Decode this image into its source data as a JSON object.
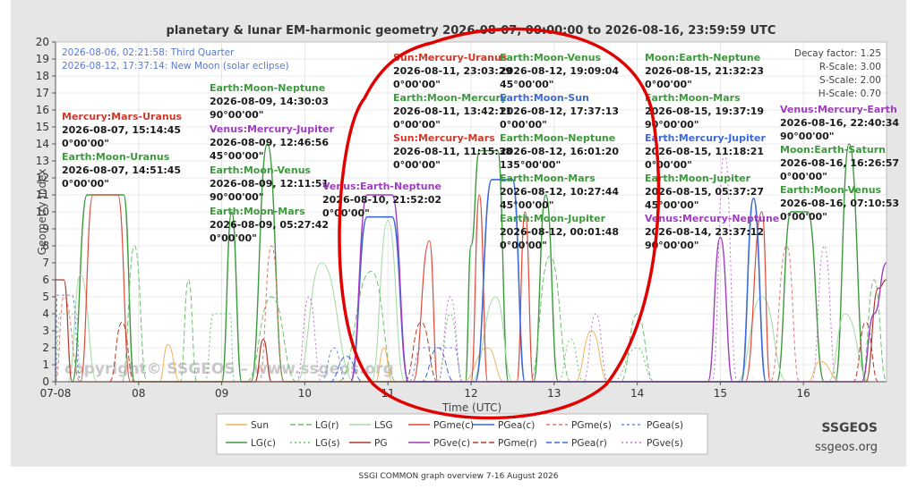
{
  "caption": "SSGI COMMON graph overview 7-16 August 2026",
  "brand": {
    "name": "SSGEOS",
    "site": "ssgeos.org",
    "watermark": "copyright© SSGEOS – www.ssgeos.org"
  },
  "colors": {
    "frame": "#e6e6e6",
    "plot_bg": "#ffffff",
    "grid": "#e2e2e2",
    "highlight_circle": "#e00000"
  },
  "chart_data": {
    "type": "line",
    "title": "planetary & lunar EM-harmonic geometry 2026-08-07, 00:00:00 to 2026-08-16, 23:59:59 UTC",
    "xlabel": "Time (UTC)",
    "ylabel": "Geometry Index",
    "xlim": [
      0,
      10
    ],
    "ylim": [
      0,
      20
    ],
    "x_ticks": [
      {
        "v": 0,
        "label": "07-08"
      },
      {
        "v": 1,
        "label": "08"
      },
      {
        "v": 2,
        "label": "09"
      },
      {
        "v": 3,
        "label": "10"
      },
      {
        "v": 4,
        "label": "11"
      },
      {
        "v": 5,
        "label": "12"
      },
      {
        "v": 6,
        "label": "13"
      },
      {
        "v": 7,
        "label": "14"
      },
      {
        "v": 8,
        "label": "15"
      },
      {
        "v": 9,
        "label": "16"
      }
    ],
    "y_ticks": [
      0,
      1,
      2,
      3,
      4,
      5,
      6,
      7,
      8,
      9,
      10,
      11,
      12,
      13,
      14,
      15,
      16,
      17,
      18,
      19,
      20
    ],
    "grid": true,
    "moon_phases": [
      {
        "text": "2026-08-06, 02:21:58: Third Quarter"
      },
      {
        "text": "2026-08-12, 17:37:14: New Moon (solar eclipse)"
      }
    ],
    "scale_info": [
      {
        "label": "Decay factor:",
        "value": "1.25"
      },
      {
        "label": "R-Scale:",
        "value": "3.00"
      },
      {
        "label": "S-Scale:",
        "value": "2.00"
      },
      {
        "label": "H-Scale:",
        "value": "0.70"
      }
    ],
    "events": [
      {
        "name": "Mercury:Mars-Uranus",
        "time": "2026-08-07, 15:14:45",
        "angle": "0°00'00\"",
        "color": "#d03a2a",
        "col": 0,
        "row": 0
      },
      {
        "name": "Earth:Moon-Uranus",
        "time": "2026-08-07, 14:51:45",
        "angle": "0°00'00\"",
        "color": "#3c9a3c",
        "col": 0,
        "row": 1
      },
      {
        "name": "Earth:Moon-Neptune",
        "time": "2026-08-09, 14:30:03",
        "angle": "90°00'00\"",
        "color": "#3c9a3c",
        "col": 1,
        "row": 0
      },
      {
        "name": "Venus:Mercury-Jupiter",
        "time": "2026-08-09, 12:46:56",
        "angle": "45°00'00\"",
        "color": "#a03cc0",
        "col": 1,
        "row": 1
      },
      {
        "name": "Earth:Moon-Venus",
        "time": "2026-08-09, 12:11:51",
        "angle": "90°00'00\"",
        "color": "#3c9a3c",
        "col": 1,
        "row": 2
      },
      {
        "name": "Earth:Moon-Mars",
        "time": "2026-08-09, 05:27:42",
        "angle": "0°00'00\"",
        "color": "#3c9a3c",
        "col": 1,
        "row": 3
      },
      {
        "name": "Venus:Earth-Neptune",
        "time": "2026-08-10, 21:52:02",
        "angle": "0°00'00\"",
        "color": "#a03cc0",
        "col": 2,
        "row": 0
      },
      {
        "name": "Sun:Mercury-Uranus",
        "time": "2026-08-11, 23:03:29",
        "angle": "0°00'00\"",
        "color": "#d03a2a",
        "col": 3,
        "row": 0
      },
      {
        "name": "Earth:Moon-Mercury",
        "time": "2026-08-11, 13:42:11",
        "angle": "0°00'00\"",
        "color": "#3c9a3c",
        "col": 3,
        "row": 1
      },
      {
        "name": "Sun:Mercury-Mars",
        "time": "2026-08-11, 11:15:38",
        "angle": "0°00'00\"",
        "color": "#d03a2a",
        "col": 3,
        "row": 2
      },
      {
        "name": "Earth:Moon-Venus",
        "time": "2026-08-12, 19:09:04",
        "angle": "45°00'00\"",
        "color": "#3c9a3c",
        "col": 4,
        "row": 0
      },
      {
        "name": "Earth:Moon-Sun",
        "time": "2026-08-12, 17:37:13",
        "angle": "0°00'00\"",
        "color": "#3c6ad8",
        "col": 4,
        "row": 1
      },
      {
        "name": "Earth:Moon-Neptune",
        "time": "2026-08-12, 16:01:20",
        "angle": "135°00'00\"",
        "color": "#3c9a3c",
        "col": 4,
        "row": 2
      },
      {
        "name": "Earth:Moon-Mars",
        "time": "2026-08-12, 10:27:44",
        "angle": "45°00'00\"",
        "color": "#3c9a3c",
        "col": 4,
        "row": 3
      },
      {
        "name": "Earth:Moon-Jupiter",
        "time": "2026-08-12, 00:01:48",
        "angle": "0°00'00\"",
        "color": "#3c9a3c",
        "col": 4,
        "row": 4
      },
      {
        "name": "Moon:Earth-Neptune",
        "time": "2026-08-15, 21:32:23",
        "angle": "0°00'00\"",
        "color": "#3c9a3c",
        "col": 5,
        "row": 0
      },
      {
        "name": "Earth:Moon-Mars",
        "time": "2026-08-15, 19:37:19",
        "angle": "90°00'00\"",
        "color": "#3c9a3c",
        "col": 5,
        "row": 1
      },
      {
        "name": "Earth:Mercury-Jupiter",
        "time": "2026-08-15, 11:18:21",
        "angle": "0°00'00\"",
        "color": "#3c6ad8",
        "col": 5,
        "row": 2
      },
      {
        "name": "Earth:Moon-Jupiter",
        "time": "2026-08-15, 05:37:27",
        "angle": "45°00'00\"",
        "color": "#3c9a3c",
        "col": 5,
        "row": 3
      },
      {
        "name": "Venus:Mercury-Neptune",
        "time": "2026-08-14, 23:37:12",
        "angle": "90°00'00\"",
        "color": "#a03cc0",
        "col": 5,
        "row": 4
      },
      {
        "name": "Venus:Mercury-Earth",
        "time": "2026-08-16, 22:40:34",
        "angle": "90°00'00\"",
        "color": "#a03cc0",
        "col": 6,
        "row": 0
      },
      {
        "name": "Moon:Earth-Saturn",
        "time": "2026-08-16, 16:26:57",
        "angle": "0°00'00\"",
        "color": "#3c9a3c",
        "col": 6,
        "row": 1
      },
      {
        "name": "Earth:Moon-Venus",
        "time": "2026-08-16, 07:10:53",
        "angle": "0°00'00\"",
        "color": "#3c9a3c",
        "col": 6,
        "row": 2
      }
    ],
    "series": [
      {
        "name": "LG(c)",
        "color": "#3c9a3c",
        "dash": "",
        "width": 1.4,
        "values": [
          [
            0.2,
            0
          ],
          [
            0.38,
            11
          ],
          [
            0.82,
            11
          ],
          [
            0.95,
            0
          ],
          [
            2.0,
            0
          ],
          [
            2.12,
            10
          ],
          [
            2.24,
            0
          ],
          [
            2.35,
            0
          ],
          [
            2.55,
            14
          ],
          [
            2.75,
            0
          ],
          [
            4.93,
            0
          ],
          [
            5.0,
            8
          ],
          [
            5.1,
            13.6
          ],
          [
            5.32,
            13.6
          ],
          [
            5.45,
            0
          ],
          [
            5.75,
            0
          ],
          [
            5.9,
            11
          ],
          [
            6.05,
            0
          ],
          [
            8.68,
            0
          ],
          [
            8.85,
            10
          ],
          [
            9.05,
            10
          ],
          [
            9.25,
            0
          ],
          [
            9.38,
            0
          ],
          [
            9.55,
            14
          ],
          [
            9.75,
            0
          ]
        ]
      },
      {
        "name": "LSG",
        "color": "#a8dca8",
        "dash": "",
        "width": 1.1,
        "values": [
          [
            0,
            0
          ],
          [
            0.15,
            0
          ],
          [
            0.3,
            6.3
          ],
          [
            0.5,
            0
          ],
          [
            2.9,
            0
          ],
          [
            3.2,
            7
          ],
          [
            3.6,
            0
          ],
          [
            3.8,
            0
          ],
          [
            4.0,
            9.5
          ],
          [
            4.2,
            0
          ],
          [
            5.0,
            0
          ],
          [
            5.3,
            5
          ],
          [
            5.5,
            0
          ],
          [
            8.2,
            0
          ],
          [
            8.5,
            5
          ],
          [
            8.8,
            0
          ],
          [
            9.3,
            0
          ],
          [
            9.5,
            4
          ],
          [
            9.8,
            0
          ]
        ]
      },
      {
        "name": "LG(r)",
        "color": "#6fc06f",
        "dash": "6,3",
        "width": 1.0,
        "values": [
          [
            0.8,
            0
          ],
          [
            0.95,
            8
          ],
          [
            1.1,
            0
          ],
          [
            1.5,
            0
          ],
          [
            1.6,
            6
          ],
          [
            1.7,
            0
          ],
          [
            2.3,
            0
          ],
          [
            2.6,
            5
          ],
          [
            2.9,
            0
          ],
          [
            3.4,
            0
          ],
          [
            3.8,
            6.5
          ],
          [
            4.1,
            0
          ],
          [
            5.7,
            0
          ],
          [
            5.95,
            7.4
          ],
          [
            6.2,
            0
          ],
          [
            6.8,
            0
          ],
          [
            7.0,
            4
          ],
          [
            7.2,
            0
          ],
          [
            9.7,
            0
          ],
          [
            9.85,
            6
          ],
          [
            10,
            0
          ]
        ]
      },
      {
        "name": "LG(s)",
        "color": "#6fc06f",
        "dash": "2,3",
        "width": 1.0,
        "values": [
          [
            0,
            0
          ],
          [
            0.05,
            4
          ],
          [
            0.25,
            4
          ],
          [
            0.3,
            0
          ],
          [
            1.8,
            0
          ],
          [
            1.9,
            4
          ],
          [
            2.1,
            4
          ],
          [
            2.15,
            0
          ],
          [
            4.6,
            0
          ],
          [
            4.75,
            4
          ],
          [
            4.9,
            0
          ],
          [
            6.05,
            0
          ],
          [
            6.2,
            2.5
          ],
          [
            6.35,
            0
          ],
          [
            6.7,
            0
          ],
          [
            7.0,
            2
          ],
          [
            7.2,
            0
          ]
        ]
      },
      {
        "name": "Sun",
        "color": "#f0b45a",
        "dash": "",
        "width": 1.0,
        "values": [
          [
            1.25,
            0
          ],
          [
            1.35,
            2.2
          ],
          [
            1.5,
            0
          ],
          [
            3.85,
            0
          ],
          [
            3.95,
            2
          ],
          [
            4.05,
            0
          ],
          [
            4.9,
            0
          ],
          [
            5.2,
            2
          ],
          [
            5.4,
            0
          ],
          [
            6.25,
            0
          ],
          [
            6.45,
            3
          ],
          [
            6.65,
            0
          ],
          [
            9.05,
            0
          ],
          [
            9.2,
            1.2
          ],
          [
            9.45,
            0
          ]
        ]
      },
      {
        "name": "PG",
        "color": "#b03a2a",
        "dash": "",
        "width": 1.2,
        "values": [
          [
            0,
            0
          ],
          [
            0.0,
            6
          ],
          [
            0.1,
            6
          ],
          [
            0.2,
            0
          ],
          [
            2.4,
            0
          ],
          [
            2.5,
            2.5
          ],
          [
            2.6,
            0
          ],
          [
            9.75,
            0
          ],
          [
            9.9,
            5.5
          ],
          [
            10,
            6
          ]
        ]
      },
      {
        "name": "PGme(c)",
        "color": "#e04a3a",
        "dash": "",
        "width": 1.2,
        "values": [
          [
            0.3,
            0
          ],
          [
            0.45,
            11
          ],
          [
            0.75,
            11
          ],
          [
            0.9,
            0
          ],
          [
            4.3,
            0
          ],
          [
            4.5,
            8.3
          ],
          [
            4.6,
            0
          ],
          [
            5.0,
            0
          ],
          [
            5.1,
            11
          ],
          [
            5.2,
            0
          ],
          [
            5.55,
            0
          ],
          [
            5.65,
            10
          ],
          [
            5.75,
            0
          ],
          [
            8.3,
            0
          ],
          [
            8.5,
            10
          ],
          [
            8.6,
            0
          ]
        ]
      },
      {
        "name": "PGme(r)",
        "color": "#b03a2a",
        "dash": "6,3",
        "width": 1.0,
        "values": [
          [
            0.65,
            0
          ],
          [
            0.8,
            3.5
          ],
          [
            0.95,
            0
          ],
          [
            4.2,
            0
          ],
          [
            4.4,
            3.5
          ],
          [
            4.6,
            0
          ],
          [
            9.6,
            0
          ],
          [
            9.75,
            3.5
          ],
          [
            9.9,
            0
          ]
        ]
      },
      {
        "name": "PGme(s)",
        "color": "#e07a70",
        "dash": "4,3",
        "width": 1.0,
        "values": [
          [
            0,
            0
          ],
          [
            0.1,
            5
          ],
          [
            0.3,
            0
          ],
          [
            2.45,
            0
          ],
          [
            2.6,
            8
          ],
          [
            2.75,
            0
          ],
          [
            8.6,
            0
          ],
          [
            8.8,
            8
          ],
          [
            8.95,
            0
          ]
        ]
      },
      {
        "name": "PGea(c)",
        "color": "#3c6ad8",
        "dash": "",
        "width": 1.6,
        "values": [
          [
            3.55,
            0
          ],
          [
            3.75,
            9.7
          ],
          [
            4.05,
            9.7
          ],
          [
            4.25,
            0
          ],
          [
            5.05,
            0
          ],
          [
            5.25,
            11.9
          ],
          [
            5.5,
            11.9
          ],
          [
            5.65,
            0
          ],
          [
            8.25,
            0
          ],
          [
            8.4,
            10.8
          ],
          [
            8.55,
            0
          ]
        ]
      },
      {
        "name": "PGea(r)",
        "color": "#3c6ad8",
        "dash": "6,3",
        "width": 1.0,
        "values": [
          [
            3.3,
            0
          ],
          [
            3.5,
            1.5
          ],
          [
            3.7,
            0
          ],
          [
            4.4,
            0
          ],
          [
            4.6,
            2
          ],
          [
            4.8,
            0
          ]
        ]
      },
      {
        "name": "PGea(s)",
        "color": "#6a8ae0",
        "dash": "3,3",
        "width": 1.0,
        "values": [
          [
            0,
            0
          ],
          [
            0.02,
            5.1
          ],
          [
            0.2,
            5.1
          ],
          [
            0.3,
            0
          ],
          [
            3.2,
            0
          ],
          [
            3.35,
            2
          ],
          [
            3.5,
            0
          ],
          [
            4.25,
            0
          ],
          [
            4.4,
            2
          ],
          [
            4.8,
            2
          ],
          [
            4.9,
            0
          ]
        ]
      },
      {
        "name": "PGve(c)",
        "color": "#a03cc0",
        "dash": "",
        "width": 1.4,
        "values": [
          [
            3.55,
            0
          ],
          [
            3.75,
            11
          ],
          [
            4.05,
            11
          ],
          [
            4.25,
            0
          ],
          [
            7.85,
            0
          ],
          [
            8.0,
            8.5
          ],
          [
            8.15,
            0
          ],
          [
            9.7,
            0
          ],
          [
            9.85,
            4
          ],
          [
            10,
            7
          ]
        ]
      },
      {
        "name": "PGve(s)",
        "color": "#c070d0",
        "dash": "2,3",
        "width": 1.0,
        "values": [
          [
            2.9,
            0
          ],
          [
            3.05,
            5
          ],
          [
            3.2,
            0
          ],
          [
            4.6,
            0
          ],
          [
            4.75,
            5
          ],
          [
            4.9,
            0
          ],
          [
            6.35,
            0
          ],
          [
            6.5,
            4
          ],
          [
            6.65,
            0
          ],
          [
            7.9,
            0
          ],
          [
            8.05,
            13.5
          ],
          [
            8.2,
            0
          ],
          [
            9.1,
            0
          ],
          [
            9.25,
            8
          ],
          [
            9.4,
            0
          ]
        ]
      }
    ],
    "legend": {
      "placement": "bottom",
      "rows": [
        [
          "Sun",
          "LG(r)",
          "LSG",
          "PGme(c)",
          "PGea(c)",
          "PGme(s)",
          "PGea(s)"
        ],
        [
          "LG(c)",
          "LG(s)",
          "PG",
          "PGve(c)",
          "PGme(r)",
          "PGea(r)",
          "PGve(s)"
        ]
      ]
    }
  }
}
